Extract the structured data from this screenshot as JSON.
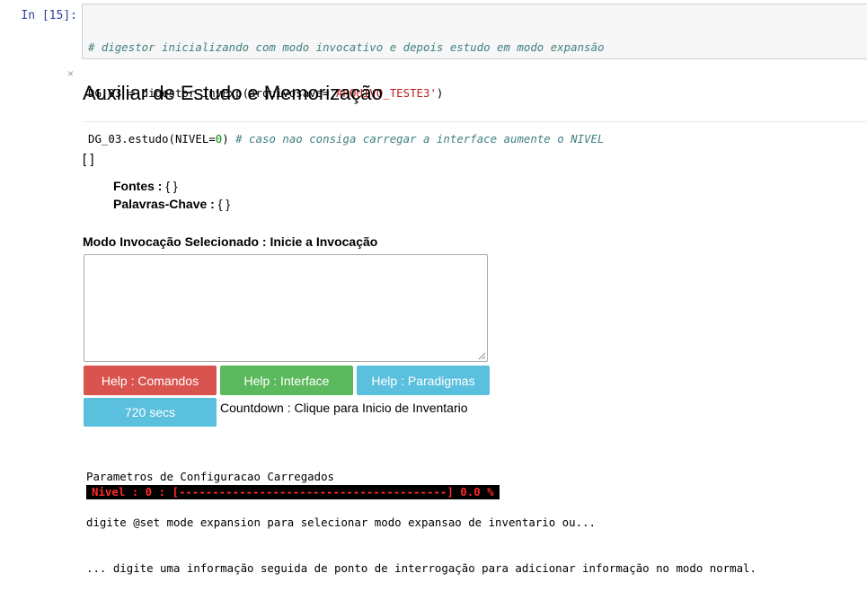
{
  "cell": {
    "prompt": "In [15]:",
    "line1_comment": "# digestor inicializando com modo invocativo e depois estudo em modo expansão",
    "line2_code": "DG_03 = digestor_InvExp(arquivosave=",
    "line2_string": "'ARQUIVO_TESTE3'",
    "line2_end": ")",
    "line3_code": "DG_03.estudo(NIVEL=",
    "line3_number": "0",
    "line3_paren": ") ",
    "line3_comment": "# caso nao consiga carregar a interface aumente o NIVEL"
  },
  "close_glyph": "×",
  "title": "Auxiliar de Estudo e Memorização",
  "empty_list": "[ ]",
  "fontes": {
    "label": "Fontes",
    "sep": " : ",
    "value": "{ }"
  },
  "palavras": {
    "label": "Palavras-Chave",
    "sep": " : ",
    "value": "{ }"
  },
  "mode_label": "Modo Invocação Selecionado : Inicie a Invocação",
  "textarea_value": "",
  "buttons": {
    "comandos": "Help : Comandos",
    "interface": "Help : Interface",
    "paradigmas": "Help : Paradigmas",
    "timer": "720 secs"
  },
  "countdown_label": "Countdown : Clique para Inicio de Inventario",
  "output_lines": [
    "Parametros de Configuracao Carregados",
    "digite @set mode expansion para selecionar modo expansao de inventario ou...",
    "... digite uma informação seguida de ponto de interrogação para adicionar informação no modo normal."
  ],
  "progress_text": "Nivel : 0 : [----------------------------------------] 0.0 %",
  "progress_value": 0.0,
  "colors": {
    "danger": "#d9534f",
    "success": "#5cb85c",
    "info": "#5bc0de",
    "prompt": "#303f9f",
    "progress_text": "#ff2a2a"
  }
}
